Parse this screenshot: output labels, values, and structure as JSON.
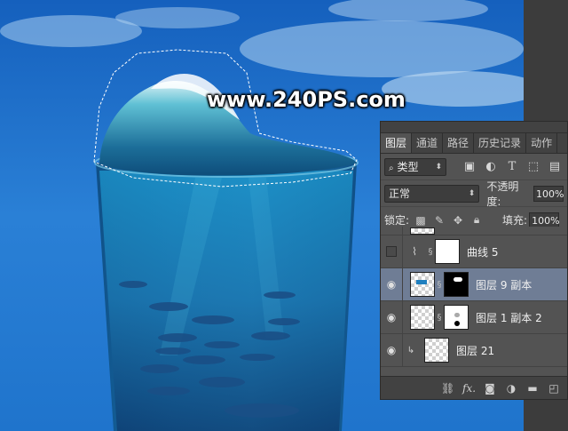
{
  "watermark": "www.240PS.com",
  "colors": {
    "sky": "#1b6fc8",
    "panel": "#535353",
    "selected_layer": "#6f7d95"
  },
  "panel": {
    "tabs": [
      "图层",
      "通道",
      "路径",
      "历史记录",
      "动作"
    ],
    "active_tab": "图层",
    "filter": {
      "label": "类型",
      "icons": [
        "image-filter-icon",
        "adjustment-filter-icon",
        "text-filter-icon",
        "shape-filter-icon",
        "smart-object-filter-icon"
      ]
    },
    "blend_mode": "正常",
    "opacity_label": "不透明度:",
    "opacity_value": "100%",
    "lock_label": "锁定:",
    "fill_label": "填充:",
    "fill_value": "100%",
    "layers": [
      {
        "name": "",
        "visible": false,
        "partial": true
      },
      {
        "name": "曲线 5",
        "visible": false,
        "type": "adjustment"
      },
      {
        "name": "图层 9 副本",
        "visible": true,
        "selected": true
      },
      {
        "name": "图层 1 副本 2",
        "visible": true
      },
      {
        "name": "图层 21",
        "visible": true,
        "clipped": true
      }
    ],
    "bottom_icons": [
      "link-icon",
      "fx-icon",
      "add-mask-icon",
      "new-adjustment-icon",
      "new-group-icon",
      "new-layer-icon"
    ],
    "bottom_fx_label": "fx."
  }
}
